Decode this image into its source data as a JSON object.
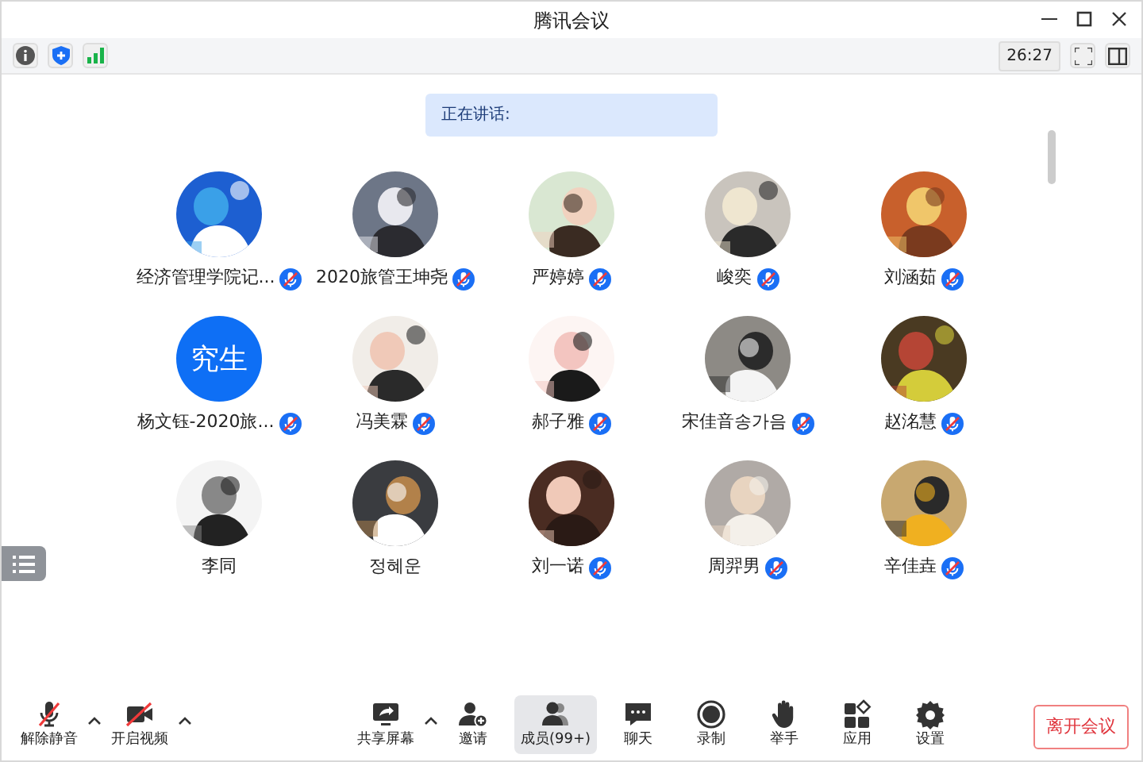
{
  "window": {
    "title": "腾讯会议"
  },
  "top_bar": {
    "timer": "26:27"
  },
  "speaking_banner": {
    "label": "正在讲话:"
  },
  "participants": [
    {
      "name": "经济管理学院记...",
      "mic_muted": true
    },
    {
      "name": "2020旅管王坤尧",
      "mic_muted": true
    },
    {
      "name": "严婷婷",
      "mic_muted": true
    },
    {
      "name": "峻奕",
      "mic_muted": true
    },
    {
      "name": "刘涵茹",
      "mic_muted": true
    },
    {
      "name": "杨文钰-2020旅...",
      "avatar": {
        "kind": "text",
        "text": "究生"
      },
      "mic_muted": true
    },
    {
      "name": "冯美霖",
      "mic_muted": true
    },
    {
      "name": "郝子雅",
      "mic_muted": true
    },
    {
      "name": "宋佳音송가음",
      "mic_muted": true
    },
    {
      "name": "赵洺慧",
      "mic_muted": true
    },
    {
      "name": "李同",
      "mic_muted": false
    },
    {
      "name": "정혜운",
      "mic_muted": false
    },
    {
      "name": "刘一诺",
      "mic_muted": true
    },
    {
      "name": "周羿男",
      "mic_muted": true
    },
    {
      "name": "辛佳垚",
      "mic_muted": true
    }
  ],
  "toolbar": [
    {
      "kind": "mute",
      "label": "解除静音",
      "caret": true,
      "selected": false
    },
    {
      "kind": "video",
      "label": "开启视频",
      "caret": true,
      "selected": false
    },
    {
      "kind": "share",
      "label": "共享屏幕",
      "caret": true,
      "selected": false
    },
    {
      "kind": "invite",
      "label": "邀请",
      "caret": false,
      "selected": false
    },
    {
      "kind": "members",
      "label": "成员(99+)",
      "caret": false,
      "selected": true
    },
    {
      "kind": "chat",
      "label": "聊天",
      "caret": false,
      "selected": false
    },
    {
      "kind": "record",
      "label": "录制",
      "caret": false,
      "selected": false
    },
    {
      "kind": "hand",
      "label": "举手",
      "caret": false,
      "selected": false
    },
    {
      "kind": "apps",
      "label": "应用",
      "caret": false,
      "selected": false
    },
    {
      "kind": "settings",
      "label": "设置",
      "caret": false,
      "selected": false
    }
  ],
  "leave_button": {
    "label": "离开会议"
  }
}
